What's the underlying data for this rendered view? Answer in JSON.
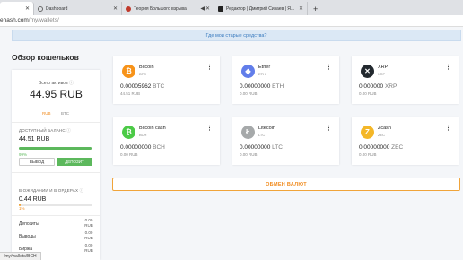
{
  "browser": {
    "tabs": [
      {
        "label": "",
        "active": true
      },
      {
        "label": "Dashboard"
      },
      {
        "label": "Теория Большого взрыва"
      },
      {
        "label": "Редактор | Дмитрий Сизаев | Я..."
      }
    ],
    "new_tab": "+",
    "url_host": "ehash.com",
    "url_path": "/my/wallets/"
  },
  "notice": "Где мои старые средства?",
  "page_title": "Обзор кошельков",
  "summary": {
    "total_label": "Всего активов",
    "total_value": "44.95 RUB",
    "currency_options": [
      "RUB",
      "BTC"
    ],
    "selected_currency": "RUB",
    "available_label": "ДОСТУПНЫЙ БАЛАНС",
    "available_value": "44.51 RUB",
    "available_pct": "99%",
    "available_fraction": 0.99,
    "withdraw_label": "ВЫВОД",
    "deposit_label": "ДЕПОЗИТ",
    "pending_label": "В ОЖИДАНИИ И В ОРДЕРАХ",
    "pending_value": "0.44 RUB",
    "pending_pct": "1%",
    "pending_fraction": 0.01,
    "rows": [
      {
        "label": "Депозиты",
        "value": "0.00 RUB"
      },
      {
        "label": "Выводы",
        "value": "0.00 RUB"
      },
      {
        "label": "Биржа",
        "value": "0.00 RUB"
      }
    ]
  },
  "wallets": [
    {
      "name": "Bitcoin",
      "symbol": "BTC",
      "balance": "0.00005962",
      "fiat": "44.51 RUB",
      "color": "#f7931a",
      "icon": "bitcoin-icon",
      "glyph": "₿"
    },
    {
      "name": "Ether",
      "symbol": "ETH",
      "balance": "0.00000000",
      "fiat": "0.00 RUB",
      "color": "#627eea",
      "icon": "ethereum-icon",
      "glyph": "◆"
    },
    {
      "name": "XRP",
      "symbol": "XRP",
      "balance": "0.000000",
      "fiat": "0.00 RUB",
      "color": "#23292f",
      "icon": "xrp-icon",
      "glyph": "✕"
    },
    {
      "name": "Bitcoin cash",
      "symbol": "BCH",
      "balance": "0.00000000",
      "fiat": "0.00 RUB",
      "color": "#4cca47",
      "icon": "bitcoin-cash-icon",
      "glyph": "₿"
    },
    {
      "name": "Litecoin",
      "symbol": "LTC",
      "balance": "0.00000000",
      "fiat": "0.00 RUB",
      "color": "#a6a9aa",
      "icon": "litecoin-icon",
      "glyph": "Ł"
    },
    {
      "name": "Zcash",
      "symbol": "ZEC",
      "balance": "0.00000000",
      "fiat": "0.00 RUB",
      "color": "#f4b728",
      "icon": "zcash-icon",
      "glyph": "Z"
    }
  ],
  "exchange_label": "ОБМЕН ВАЛЮТ",
  "status_url": "/my/wallets/BCH",
  "colors": {
    "accent_green": "#5cb85c",
    "accent_orange": "#f08a1c",
    "link_blue": "#3a7bbf"
  }
}
